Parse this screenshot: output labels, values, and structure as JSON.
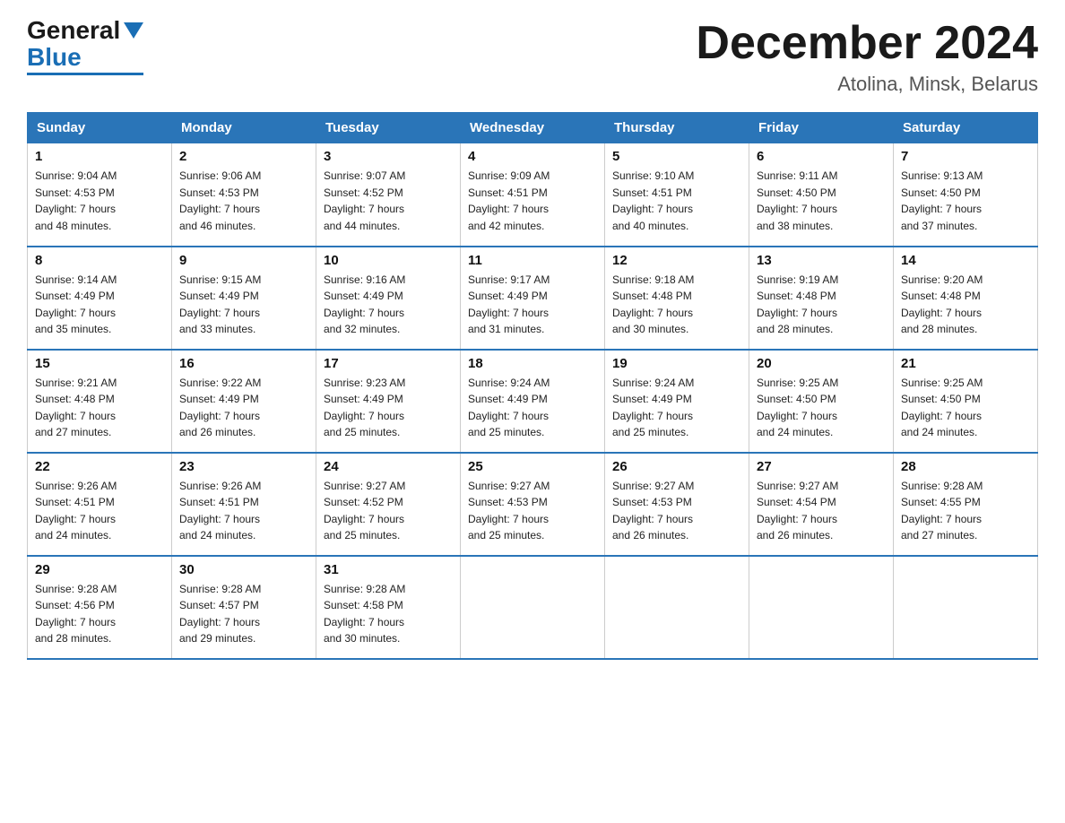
{
  "header": {
    "logo_general": "General",
    "logo_blue": "Blue",
    "month_year": "December 2024",
    "location": "Atolina, Minsk, Belarus"
  },
  "days_of_week": [
    "Sunday",
    "Monday",
    "Tuesday",
    "Wednesday",
    "Thursday",
    "Friday",
    "Saturday"
  ],
  "weeks": [
    [
      {
        "day": "1",
        "sunrise": "9:04 AM",
        "sunset": "4:53 PM",
        "daylight": "7 hours and 48 minutes."
      },
      {
        "day": "2",
        "sunrise": "9:06 AM",
        "sunset": "4:53 PM",
        "daylight": "7 hours and 46 minutes."
      },
      {
        "day": "3",
        "sunrise": "9:07 AM",
        "sunset": "4:52 PM",
        "daylight": "7 hours and 44 minutes."
      },
      {
        "day": "4",
        "sunrise": "9:09 AM",
        "sunset": "4:51 PM",
        "daylight": "7 hours and 42 minutes."
      },
      {
        "day": "5",
        "sunrise": "9:10 AM",
        "sunset": "4:51 PM",
        "daylight": "7 hours and 40 minutes."
      },
      {
        "day": "6",
        "sunrise": "9:11 AM",
        "sunset": "4:50 PM",
        "daylight": "7 hours and 38 minutes."
      },
      {
        "day": "7",
        "sunrise": "9:13 AM",
        "sunset": "4:50 PM",
        "daylight": "7 hours and 37 minutes."
      }
    ],
    [
      {
        "day": "8",
        "sunrise": "9:14 AM",
        "sunset": "4:49 PM",
        "daylight": "7 hours and 35 minutes."
      },
      {
        "day": "9",
        "sunrise": "9:15 AM",
        "sunset": "4:49 PM",
        "daylight": "7 hours and 33 minutes."
      },
      {
        "day": "10",
        "sunrise": "9:16 AM",
        "sunset": "4:49 PM",
        "daylight": "7 hours and 32 minutes."
      },
      {
        "day": "11",
        "sunrise": "9:17 AM",
        "sunset": "4:49 PM",
        "daylight": "7 hours and 31 minutes."
      },
      {
        "day": "12",
        "sunrise": "9:18 AM",
        "sunset": "4:48 PM",
        "daylight": "7 hours and 30 minutes."
      },
      {
        "day": "13",
        "sunrise": "9:19 AM",
        "sunset": "4:48 PM",
        "daylight": "7 hours and 28 minutes."
      },
      {
        "day": "14",
        "sunrise": "9:20 AM",
        "sunset": "4:48 PM",
        "daylight": "7 hours and 28 minutes."
      }
    ],
    [
      {
        "day": "15",
        "sunrise": "9:21 AM",
        "sunset": "4:48 PM",
        "daylight": "7 hours and 27 minutes."
      },
      {
        "day": "16",
        "sunrise": "9:22 AM",
        "sunset": "4:49 PM",
        "daylight": "7 hours and 26 minutes."
      },
      {
        "day": "17",
        "sunrise": "9:23 AM",
        "sunset": "4:49 PM",
        "daylight": "7 hours and 25 minutes."
      },
      {
        "day": "18",
        "sunrise": "9:24 AM",
        "sunset": "4:49 PM",
        "daylight": "7 hours and 25 minutes."
      },
      {
        "day": "19",
        "sunrise": "9:24 AM",
        "sunset": "4:49 PM",
        "daylight": "7 hours and 25 minutes."
      },
      {
        "day": "20",
        "sunrise": "9:25 AM",
        "sunset": "4:50 PM",
        "daylight": "7 hours and 24 minutes."
      },
      {
        "day": "21",
        "sunrise": "9:25 AM",
        "sunset": "4:50 PM",
        "daylight": "7 hours and 24 minutes."
      }
    ],
    [
      {
        "day": "22",
        "sunrise": "9:26 AM",
        "sunset": "4:51 PM",
        "daylight": "7 hours and 24 minutes."
      },
      {
        "day": "23",
        "sunrise": "9:26 AM",
        "sunset": "4:51 PM",
        "daylight": "7 hours and 24 minutes."
      },
      {
        "day": "24",
        "sunrise": "9:27 AM",
        "sunset": "4:52 PM",
        "daylight": "7 hours and 25 minutes."
      },
      {
        "day": "25",
        "sunrise": "9:27 AM",
        "sunset": "4:53 PM",
        "daylight": "7 hours and 25 minutes."
      },
      {
        "day": "26",
        "sunrise": "9:27 AM",
        "sunset": "4:53 PM",
        "daylight": "7 hours and 26 minutes."
      },
      {
        "day": "27",
        "sunrise": "9:27 AM",
        "sunset": "4:54 PM",
        "daylight": "7 hours and 26 minutes."
      },
      {
        "day": "28",
        "sunrise": "9:28 AM",
        "sunset": "4:55 PM",
        "daylight": "7 hours and 27 minutes."
      }
    ],
    [
      {
        "day": "29",
        "sunrise": "9:28 AM",
        "sunset": "4:56 PM",
        "daylight": "7 hours and 28 minutes."
      },
      {
        "day": "30",
        "sunrise": "9:28 AM",
        "sunset": "4:57 PM",
        "daylight": "7 hours and 29 minutes."
      },
      {
        "day": "31",
        "sunrise": "9:28 AM",
        "sunset": "4:58 PM",
        "daylight": "7 hours and 30 minutes."
      },
      null,
      null,
      null,
      null
    ]
  ],
  "labels": {
    "sunrise": "Sunrise:",
    "sunset": "Sunset:",
    "daylight": "Daylight:"
  }
}
